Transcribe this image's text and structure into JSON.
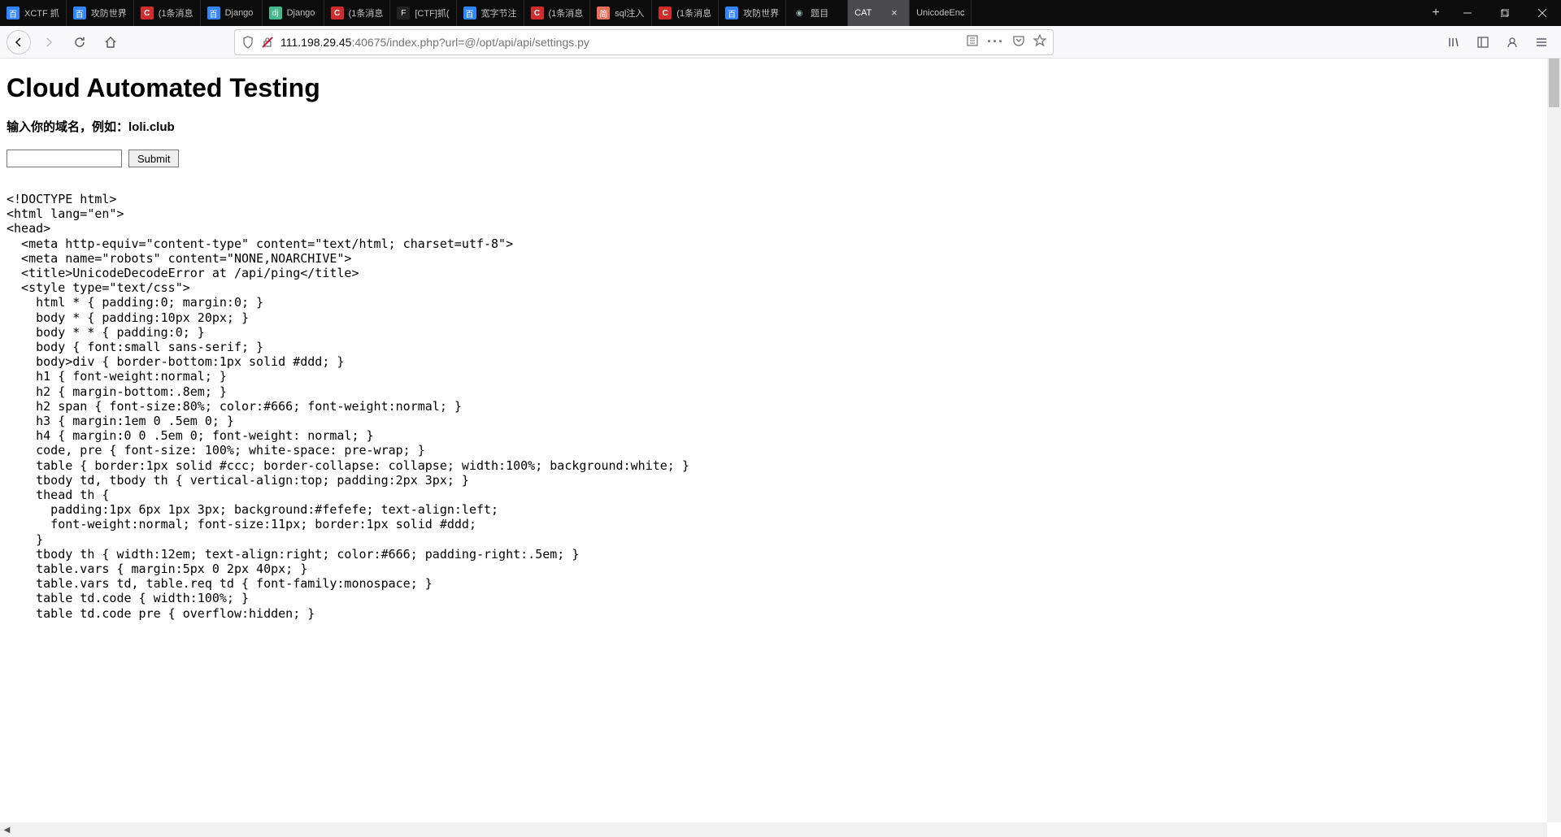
{
  "window": {
    "tabs": [
      {
        "label": "XCTF 抓",
        "favicon_class": "fv-baidu",
        "favicon_text": "百"
      },
      {
        "label": "攻防世界",
        "favicon_class": "fv-baidu",
        "favicon_text": "百"
      },
      {
        "label": "(1条消息",
        "favicon_class": "fv-c",
        "favicon_text": "C"
      },
      {
        "label": "Django",
        "favicon_class": "fv-baidu",
        "favicon_text": "百"
      },
      {
        "label": "Django",
        "favicon_class": "fv-djangogreen2",
        "favicon_text": "dj"
      },
      {
        "label": "(1条消息",
        "favicon_class": "fv-c",
        "favicon_text": "C"
      },
      {
        "label": "[CTF]抓(",
        "favicon_class": "fv-freebuf",
        "favicon_text": "F"
      },
      {
        "label": "宽字节注",
        "favicon_class": "fv-baidu",
        "favicon_text": "百"
      },
      {
        "label": "(1条消息",
        "favicon_class": "fv-c",
        "favicon_text": "C"
      },
      {
        "label": "sql注入",
        "favicon_class": "fv-jianshu",
        "favicon_text": "简"
      },
      {
        "label": "(1条消息",
        "favicon_class": "fv-c",
        "favicon_text": "C"
      },
      {
        "label": "攻防世界",
        "favicon_class": "fv-baidu",
        "favicon_text": "百"
      },
      {
        "label": "题目",
        "favicon_class": "fv-globe",
        "favicon_text": "◉"
      },
      {
        "label": "CAT",
        "favicon_class": "",
        "favicon_text": "",
        "active": true,
        "closeable": true
      },
      {
        "label": "UnicodeEnc",
        "favicon_class": "",
        "favicon_text": ""
      }
    ]
  },
  "urlbar": {
    "host": "111.198.29.45",
    "rest": ":40675/index.php?url=@/opt/api/api/settings.py"
  },
  "page": {
    "heading": "Cloud Automated Testing",
    "prompt": "输入你的域名，例如：loli.club",
    "submit_label": "Submit",
    "code": "<!DOCTYPE html>\n<html lang=\"en\">\n<head>\n  <meta http-equiv=\"content-type\" content=\"text/html; charset=utf-8\">\n  <meta name=\"robots\" content=\"NONE,NOARCHIVE\">\n  <title>UnicodeDecodeError at /api/ping</title>\n  <style type=\"text/css\">\n    html * { padding:0; margin:0; }\n    body * { padding:10px 20px; }\n    body * * { padding:0; }\n    body { font:small sans-serif; }\n    body>div { border-bottom:1px solid #ddd; }\n    h1 { font-weight:normal; }\n    h2 { margin-bottom:.8em; }\n    h2 span { font-size:80%; color:#666; font-weight:normal; }\n    h3 { margin:1em 0 .5em 0; }\n    h4 { margin:0 0 .5em 0; font-weight: normal; }\n    code, pre { font-size: 100%; white-space: pre-wrap; }\n    table { border:1px solid #ccc; border-collapse: collapse; width:100%; background:white; }\n    tbody td, tbody th { vertical-align:top; padding:2px 3px; }\n    thead th {\n      padding:1px 6px 1px 3px; background:#fefefe; text-align:left;\n      font-weight:normal; font-size:11px; border:1px solid #ddd;\n    }\n    tbody th { width:12em; text-align:right; color:#666; padding-right:.5em; }\n    table.vars { margin:5px 0 2px 40px; }\n    table.vars td, table.req td { font-family:monospace; }\n    table td.code { width:100%; }\n    table td.code pre { overflow:hidden; }"
  }
}
